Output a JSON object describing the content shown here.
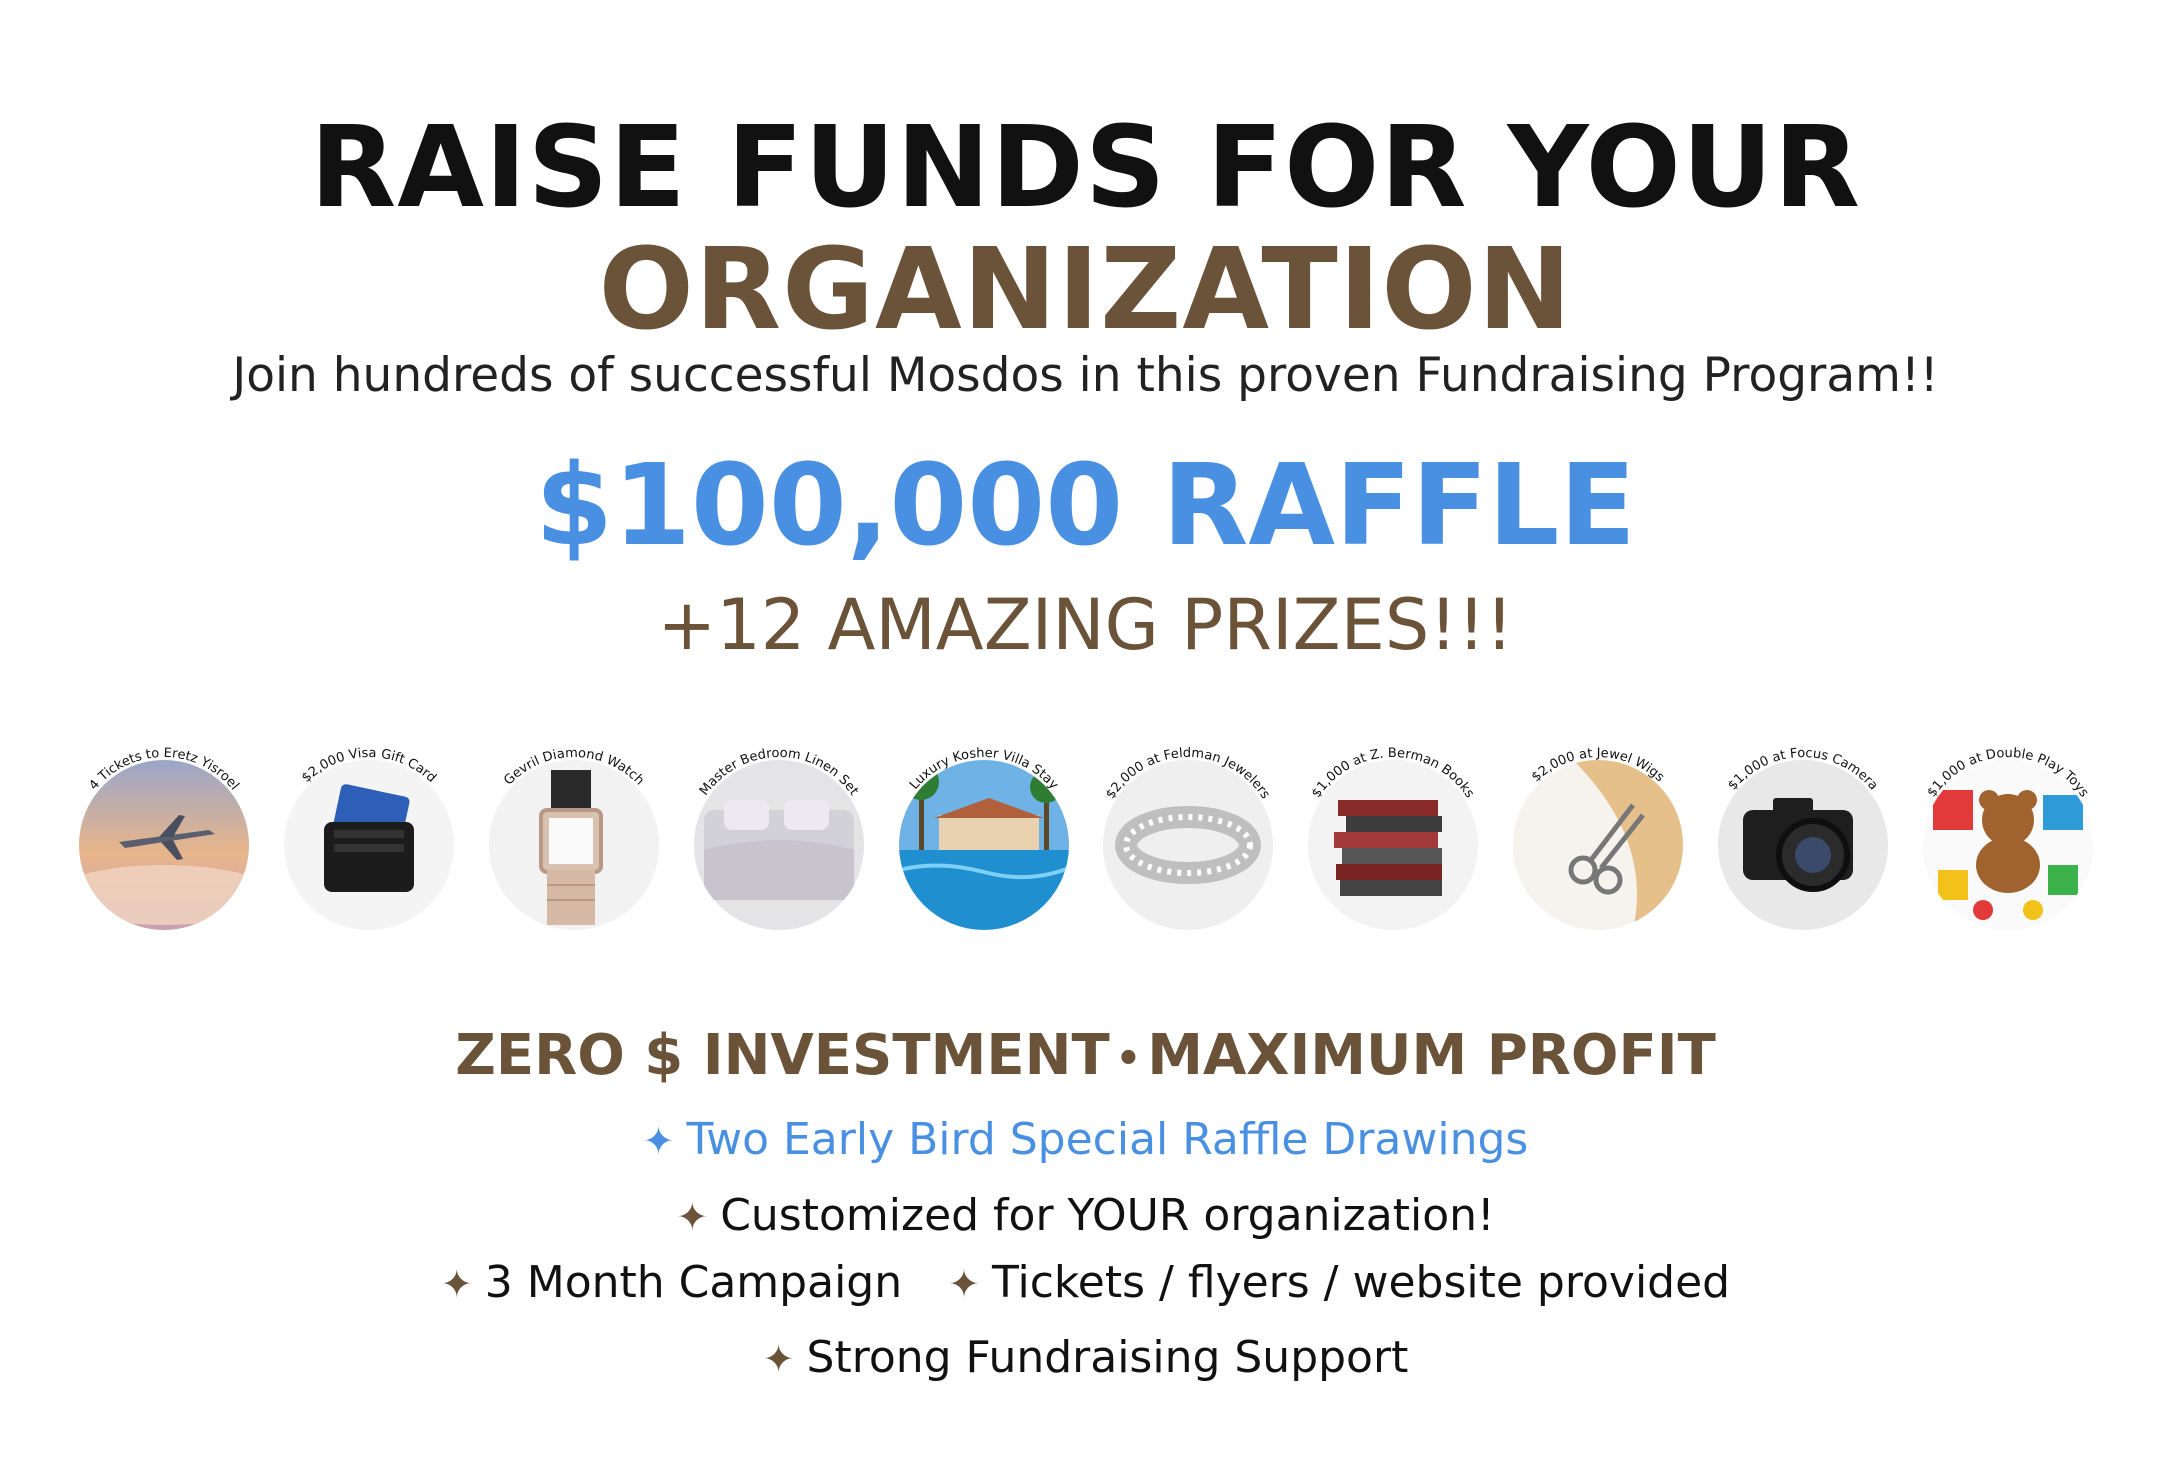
{
  "headline": {
    "line1": "RAISE FUNDS FOR YOUR",
    "line2": "ORGANIZATION"
  },
  "subheadline": "Join hundreds of successful Mosdos in this proven Fundraising Program!!",
  "raffle": {
    "title": "$100,000 RAFFLE",
    "prizes": "+12 AMAZING PRIZES!!!"
  },
  "prize_items": [
    {
      "label": "4 Tickets to Eretz Yisroel",
      "icon": "airplane-icon"
    },
    {
      "label": "$2,000 Visa Gift Card",
      "icon": "gift-card-wallet-icon"
    },
    {
      "label": "Gevril Diamond Watch",
      "icon": "watch-icon"
    },
    {
      "label": "Master Bedroom Linen Set",
      "icon": "bed-linen-icon"
    },
    {
      "label": "Luxury Kosher Villa Stay",
      "icon": "villa-pool-icon"
    },
    {
      "label": "$2,000 at Feldman Jewelers",
      "icon": "bracelet-icon"
    },
    {
      "label": "$1,000 at Z. Berman Books",
      "icon": "books-icon"
    },
    {
      "label": "$2,000 at Jewel Wigs",
      "icon": "wig-scissors-icon"
    },
    {
      "label": "$1,000 at Focus Camera",
      "icon": "camera-icon"
    },
    {
      "label": "$1,000 at Double Play Toys",
      "icon": "toys-teddy-icon"
    }
  ],
  "tagline": {
    "left": "ZERO $ INVESTMENT",
    "separator": "•",
    "right": "MAXIMUM PROFIT"
  },
  "bullet_symbol": "✦",
  "bullets": {
    "early_bird": "Two Early Bird Special Raffle Drawings",
    "customized": "Customized for YOUR organization!",
    "campaign": "3 Month Campaign",
    "materials": "Tickets / flyers / website provided",
    "support": "Strong Fundraising Support"
  },
  "colors": {
    "brown": "#6b5339",
    "blue": "#4a90e2",
    "black": "#111111"
  }
}
